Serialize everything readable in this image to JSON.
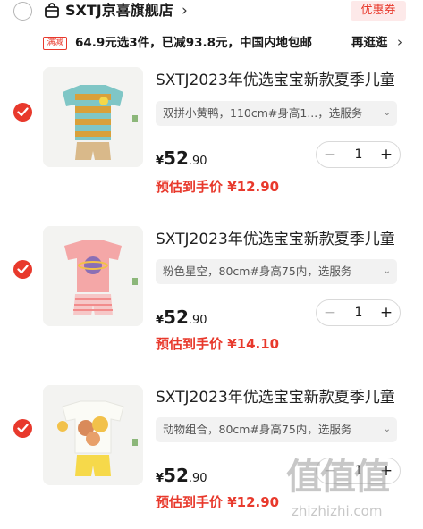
{
  "shop": {
    "name": "SXTJ京喜旗舰店",
    "chevron": "›",
    "coupon_label": "优惠券",
    "icon": "shop-bag-icon"
  },
  "promo": {
    "tag": "满减",
    "text": "64.9元选3件，已减93.8元，中国内地包邮",
    "link": "再逛逛",
    "chevron": "›"
  },
  "items": [
    {
      "title": "SXTJ2023年优选宝宝新款夏季儿童",
      "spec": "双拼小黄鸭，110cm#身高1...，选服务",
      "currency": "¥",
      "price_int": "52",
      "price_dec": ".90",
      "quantity": "1",
      "minus": "−",
      "plus": "+",
      "estimate": "预估到手价 ¥12.90",
      "checked": true
    },
    {
      "title": "SXTJ2023年优选宝宝新款夏季儿童",
      "spec": "粉色星空，80cm#身高75内，选服务",
      "currency": "¥",
      "price_int": "52",
      "price_dec": ".90",
      "quantity": "1",
      "minus": "−",
      "plus": "+",
      "estimate": "预估到手价 ¥14.10",
      "checked": true
    },
    {
      "title": "SXTJ2023年优选宝宝新款夏季儿童",
      "spec": "动物组合，80cm#身高75内，选服务",
      "currency": "¥",
      "price_int": "52",
      "price_dec": ".90",
      "quantity": "1",
      "minus": "−",
      "plus": "+",
      "estimate": "预估到手价 ¥12.90",
      "checked": true
    }
  ],
  "watermark": {
    "logo": "值值值",
    "url": "zhizhizhi.com"
  },
  "colors": {
    "accent": "#e8392c",
    "coupon_bg": "#fde9e9"
  }
}
